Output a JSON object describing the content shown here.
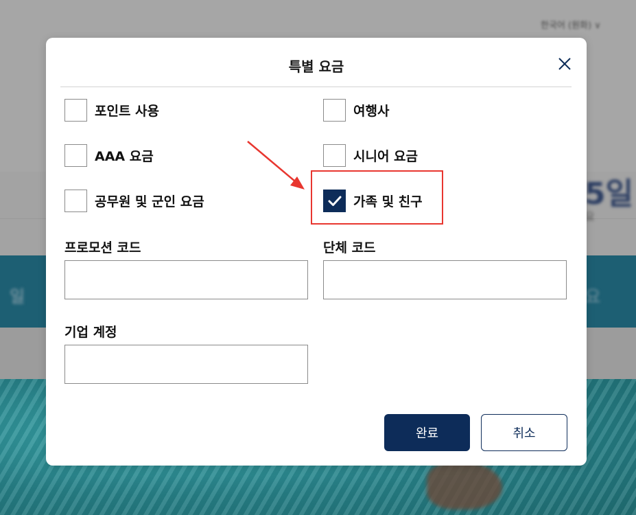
{
  "background": {
    "language_selector": "한국어 (원화) ∨"
  },
  "dialog": {
    "title": "특별 요금",
    "close_icon": "close-icon",
    "options": {
      "points": {
        "label": "포인트 사용",
        "checked": false
      },
      "travel_agent": {
        "label": "여행사",
        "checked": false
      },
      "aaa": {
        "label": "AAA 요금",
        "checked": false
      },
      "senior": {
        "label": "시니어 요금",
        "checked": false
      },
      "government": {
        "label": "공무원 및 군인 요금",
        "checked": false
      },
      "friends_family": {
        "label": "가족 및 친구",
        "checked": true
      }
    },
    "fields": {
      "promo_code": {
        "label": "프로모션 코드",
        "value": ""
      },
      "group_code": {
        "label": "단체 코드",
        "value": ""
      },
      "corporate_account": {
        "label": "기업 계정",
        "value": ""
      }
    },
    "buttons": {
      "done": "완료",
      "cancel": "취소"
    }
  },
  "colors": {
    "primary": "#0d2c59",
    "highlight": "#e8362f"
  }
}
